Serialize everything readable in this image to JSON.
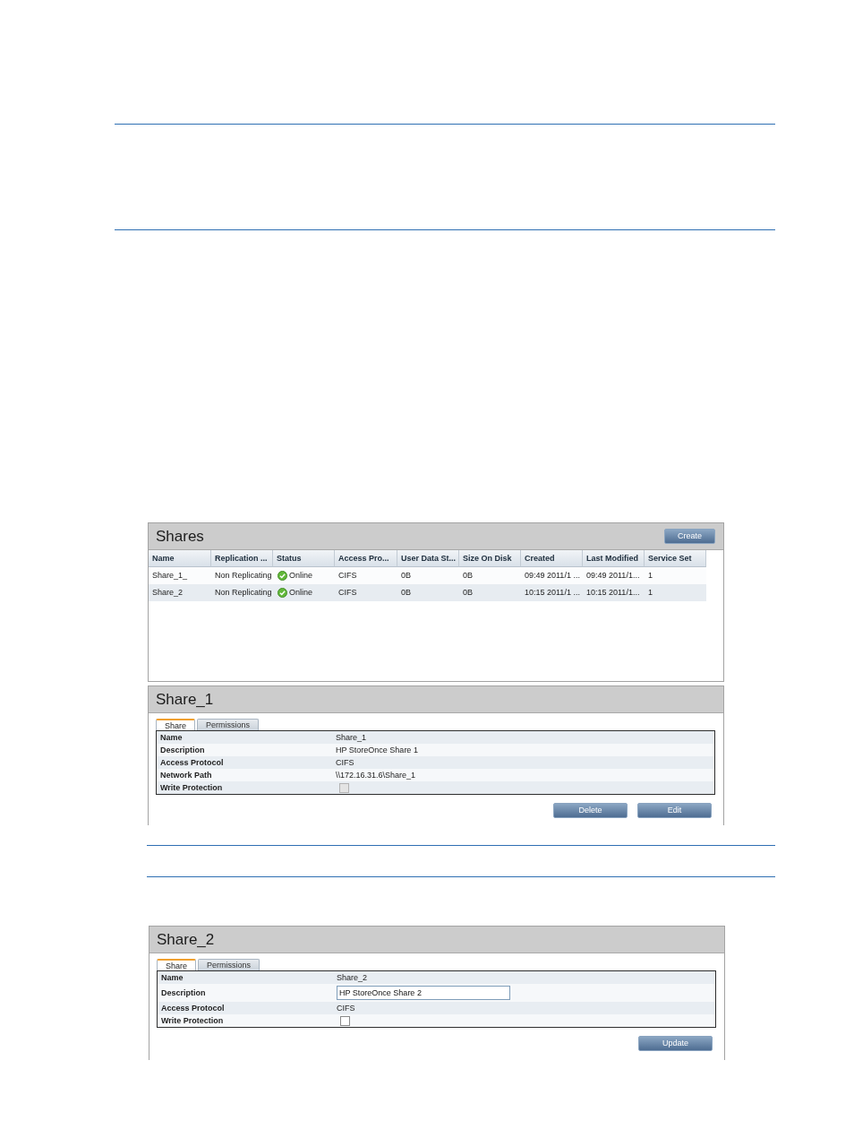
{
  "shares_panel": {
    "title": "Shares",
    "create_button": "Create",
    "columns": [
      {
        "label": "Name",
        "kind": "text"
      },
      {
        "label": "Replication ...",
        "kind": "text"
      },
      {
        "label": "Status",
        "kind": "status"
      },
      {
        "label": "Access Pro...",
        "kind": "text"
      },
      {
        "label": "User Data St...",
        "kind": "text"
      },
      {
        "label": "Size On Disk",
        "kind": "text"
      },
      {
        "label": "Created",
        "kind": "text"
      },
      {
        "label": "Last Modified",
        "kind": "text"
      },
      {
        "label": "Service Set",
        "kind": "text"
      }
    ],
    "rows": [
      [
        "Share_1_",
        "Non Replicating",
        "Online",
        "CIFS",
        "0B",
        "0B",
        "09:49 2011/1 ...",
        "09:49 2011/1...",
        "1"
      ],
      [
        "Share_2",
        "Non Replicating",
        "Online",
        "CIFS",
        "0B",
        "0B",
        "10:15 2011/1 ...",
        "10:15 2011/1...",
        "1"
      ]
    ]
  },
  "detail_panels": [
    {
      "title": "Share_1",
      "tabs": [
        {
          "label": "Share",
          "selected": true
        },
        {
          "label": "Permissions",
          "selected": false
        }
      ],
      "fields": [
        {
          "kind": "text",
          "label": "Name",
          "value": "Share_1"
        },
        {
          "kind": "text",
          "label": "Description",
          "value": "HP StoreOnce Share 1"
        },
        {
          "kind": "text",
          "label": "Access Protocol",
          "value": "CIFS"
        },
        {
          "kind": "text",
          "label": "Network Path",
          "value": "\\\\172.16.31.6\\Share_1"
        },
        {
          "kind": "checkbox",
          "label": "Write Protection",
          "checked": false,
          "disabled": true
        }
      ],
      "buttons": [
        "Delete",
        "Edit"
      ]
    },
    {
      "title": "Share_2",
      "tabs": [
        {
          "label": "Share",
          "selected": true
        },
        {
          "label": "Permissions",
          "selected": false
        }
      ],
      "fields": [
        {
          "kind": "text",
          "label": "Name",
          "value": "Share_2"
        },
        {
          "kind": "input",
          "label": "Description",
          "value": "HP StoreOnce Share 2"
        },
        {
          "kind": "text",
          "label": "Access Protocol",
          "value": "CIFS"
        },
        {
          "kind": "checkbox",
          "label": "Write Protection",
          "checked": false,
          "disabled": false
        }
      ],
      "buttons": [
        "Update"
      ]
    }
  ]
}
